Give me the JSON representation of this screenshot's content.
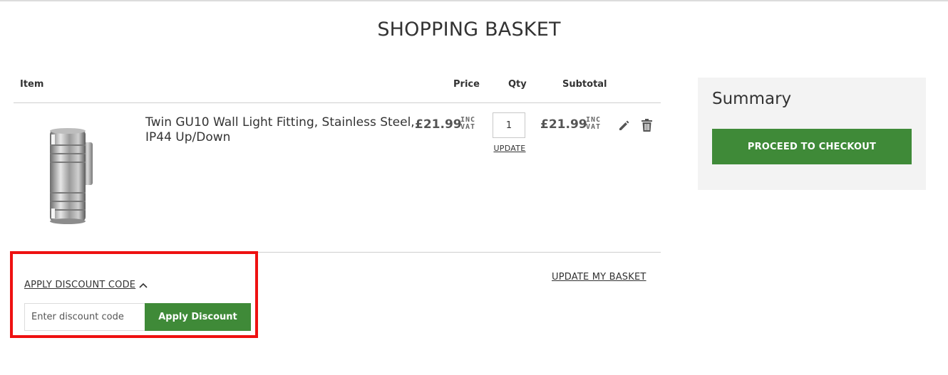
{
  "page": {
    "title": "SHOPPING BASKET"
  },
  "cart": {
    "headers": {
      "item": "Item",
      "price": "Price",
      "qty": "Qty",
      "subtotal": "Subtotal"
    },
    "items": [
      {
        "name": "Twin GU10 Wall Light Fitting, Stainless Steel, IP44 Up/Down",
        "price": "£21.99",
        "vat_label": [
          "INC",
          "VAT"
        ],
        "qty": "1",
        "update_label": "UPDATE",
        "subtotal": "£21.99",
        "subtotal_vat_label": [
          "INC",
          "VAT"
        ]
      }
    ],
    "update_basket_label": "UPDATE MY BASKET"
  },
  "discount": {
    "toggle_label": "APPLY DISCOUNT CODE",
    "input_placeholder": "Enter discount code",
    "input_value": "",
    "apply_label": "Apply Discount"
  },
  "summary": {
    "title": "Summary",
    "checkout_label": "PROCEED TO CHECKOUT"
  },
  "colors": {
    "accent_green": "#3f8a38",
    "highlight_red": "#ee1111",
    "panel_bg": "#f3f3f3"
  },
  "icons": {
    "edit": "pencil-icon",
    "delete": "trash-icon",
    "toggle": "chevron-up-icon"
  }
}
